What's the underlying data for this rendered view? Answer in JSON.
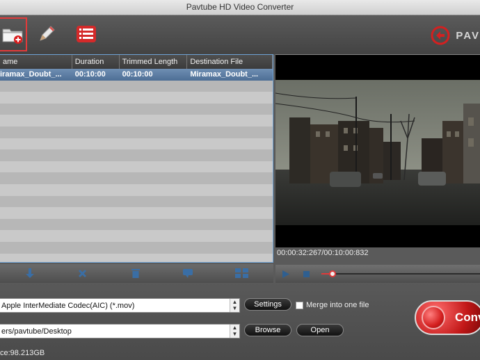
{
  "window": {
    "title": "Pavtube HD Video Converter"
  },
  "brand": {
    "text": "PAV"
  },
  "table": {
    "headers": [
      "ame",
      "Duration",
      "Trimmed Length",
      "Destination File"
    ],
    "rows": [
      [
        "iramax_Doubt_...",
        "00:10:00",
        "00:10:00",
        "Miramax_Doubt_..."
      ]
    ],
    "empty_rows": 16
  },
  "preview": {
    "time": "00:00:32:267/00:10:00:832",
    "progress": 0.07
  },
  "format": {
    "value": "Apple InterMediate Codec(AIC) (*.mov)"
  },
  "settings_label": "Settings",
  "merge_label": "Merge into one file",
  "output": {
    "value": "ers/pavtube/Desktop"
  },
  "browse_label": "Browse",
  "open_label": "Open",
  "free_space": "ce:98.213GB",
  "convert_label": "Conv",
  "colors": {
    "highlight": "#e23b3b",
    "selection": "#5a7ca3",
    "accent": "#6fa3d6"
  },
  "icons": {
    "toolbar": [
      "add-folder-icon",
      "edit-pencil-icon",
      "task-list-icon"
    ],
    "actions": [
      "move-down-icon",
      "remove-icon",
      "trash-icon",
      "comment-icon",
      "merge-icon"
    ]
  }
}
